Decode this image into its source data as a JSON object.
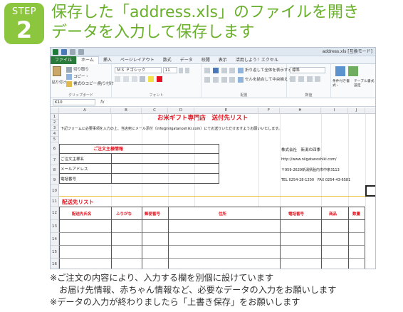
{
  "step": {
    "word": "STEP",
    "number": "2"
  },
  "headline": {
    "line1": "保存した「address.xls」のファイルを開き",
    "line2": "データを入力して保存します"
  },
  "excel": {
    "window_title": "address.xls [互換モード]",
    "tabs": [
      "ファイル",
      "ホーム",
      "挿入",
      "ページレイアウト",
      "数式",
      "データ",
      "校閲",
      "表示",
      "活用しよう！エクセル"
    ],
    "ribbon": {
      "clipboard": {
        "paste": "貼り付け",
        "cut": "切り取り",
        "copy": "コピー・",
        "format_painter": "書式のコピー/貼り付け",
        "label": "クリップボード"
      },
      "font": {
        "name": "ＭＳ Ｐゴシック",
        "size": "11",
        "label": "フォント"
      },
      "alignment": {
        "wrap": "折り返して全体を表示する",
        "merge": "セルを結合して中央揃え・",
        "label": "配置"
      },
      "number": {
        "format": "標準",
        "label": "数値"
      },
      "styles": {
        "conditional": "条件付き書式・",
        "table": "テーブル書式設定"
      }
    },
    "name_box": "K10",
    "fx": "fx",
    "columns": [
      "A",
      "B",
      "C",
      "D",
      "E",
      "F",
      "H",
      "I",
      "J"
    ],
    "rows": [
      "1",
      "2",
      "3",
      "4",
      "5",
      "6",
      "7",
      "8",
      "9",
      "10",
      "11",
      "12",
      "13",
      "14",
      "15",
      "16"
    ],
    "sheet": {
      "title": "お米ギフト専門店　送付先リスト",
      "instruction": "下記フォームに必要事項を入力の上、当店宛にメール添付（info@niigatanoshiki.com）にてお送りいただけますようお願いいたします。",
      "order_header": "ご注文主様情報",
      "order_fields": [
        "ご注文主様名",
        "メールアドレス",
        "電話番号"
      ],
      "shop": {
        "company": "株式会社　新潟の四季",
        "url": "http://www.niigatanoshiki.com/",
        "address": "〒959-2629新潟県胎内市中条3113",
        "tel": "TEL 0254-28-1200　FAX 0254-43-6581"
      },
      "list_title": "配送先リスト",
      "list_headers": [
        "配送先氏名",
        "ふりがな",
        "郵便番号",
        "住所",
        "電話番号",
        "商品",
        "数量"
      ]
    }
  },
  "notes": [
    "※ご注文の内容により、入力する欄を別個に設けています",
    "お届け先情報、赤ちゃん情報など、必要なデータの入力をお願いします",
    "※データの入力が終わりましたら「上書き保存」をお願いします"
  ],
  "colors": {
    "accent_green": "#8cc63f",
    "headline_green": "#69b02a",
    "sheet_red": "#e4121e",
    "excel_file_tab": "#2a7a3b"
  }
}
